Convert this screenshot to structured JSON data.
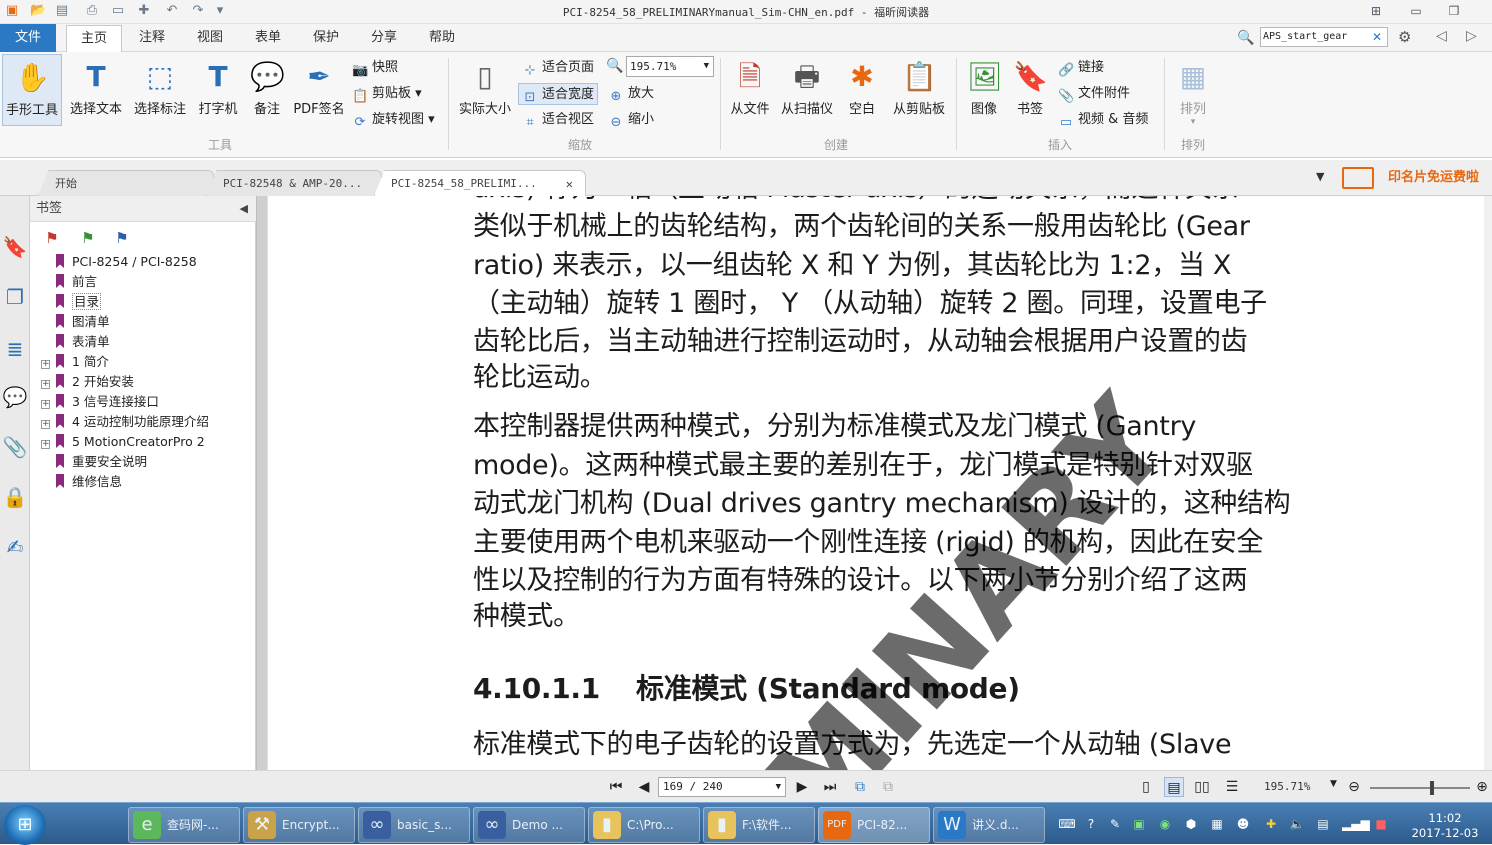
{
  "window": {
    "title": "PCI-8254_58_PRELIMINARYmanual_Sim-CHN_en.pdf - 福昕阅读器"
  },
  "menubar": {
    "items": [
      {
        "label": "文件"
      },
      {
        "label": "主页"
      },
      {
        "label": "注释"
      },
      {
        "label": "视图"
      },
      {
        "label": "表单"
      },
      {
        "label": "保护"
      },
      {
        "label": "分享"
      },
      {
        "label": "帮助"
      }
    ],
    "search_value": "APS_start_gear"
  },
  "ribbon": {
    "tools": [
      {
        "label": "手形工具",
        "icon": "hand-icon"
      },
      {
        "label": "选择文本",
        "icon": "text-select-icon"
      },
      {
        "label": "选择标注",
        "icon": "annotation-select-icon"
      },
      {
        "label": "打字机",
        "icon": "typewriter-icon"
      },
      {
        "label": "备注",
        "icon": "note-icon"
      },
      {
        "label": "PDF签名",
        "icon": "signature-icon"
      }
    ],
    "tools_small": [
      {
        "label": "快照",
        "icon": "camera-icon"
      },
      {
        "label": "剪贴板",
        "icon": "clipboard-icon"
      },
      {
        "label": "旋转视图",
        "icon": "rotate-icon"
      }
    ],
    "tools_group": "工具",
    "actual_size": "实际大小",
    "zoom_small": [
      {
        "label": "适合页面"
      },
      {
        "label": "适合宽度"
      },
      {
        "label": "适合视区"
      }
    ],
    "zoom_value": "195.71%",
    "zoom_in": "放大",
    "zoom_out": "缩小",
    "zoom_group": "缩放",
    "create": [
      {
        "label": "从文件"
      },
      {
        "label": "从扫描仪"
      },
      {
        "label": "空白"
      },
      {
        "label": "从剪贴板"
      }
    ],
    "create_group": "创建",
    "insert_big": [
      {
        "label": "图像"
      },
      {
        "label": "书签"
      }
    ],
    "insert_small": [
      {
        "label": "链接"
      },
      {
        "label": "文件附件"
      },
      {
        "label": "视频 & 音频"
      }
    ],
    "insert_group": "插入",
    "arrange": "排列",
    "arrange_group": "排列"
  },
  "tabs": [
    {
      "label": "开始"
    },
    {
      "label": "PCI-82548 & AMP-20..."
    },
    {
      "label": "PCI-8254_58_PRELIMI..."
    }
  ],
  "ad_text": "印名片免运费啦",
  "bookmarks": {
    "title": "书签",
    "items": [
      {
        "label": "PCI-8254 / PCI-8258",
        "expandable": false
      },
      {
        "label": "前言",
        "expandable": false
      },
      {
        "label": "目录",
        "expandable": false
      },
      {
        "label": "图清单",
        "expandable": false
      },
      {
        "label": "表清单",
        "expandable": false
      },
      {
        "label": "1 简介",
        "expandable": true
      },
      {
        "label": "2 开始安装",
        "expandable": true
      },
      {
        "label": "3 信号连接接口",
        "expandable": true
      },
      {
        "label": "4 运动控制功能原理介绍",
        "expandable": true
      },
      {
        "label": "5 MotionCreatorPro 2",
        "expandable": true
      },
      {
        "label": "重要安全说明",
        "expandable": false
      },
      {
        "label": "维修信息",
        "expandable": false
      }
    ]
  },
  "document": {
    "lines": [
      "axis) 称为一轴（主动轴 Master axis）的运动关系，而这种关系",
      "类似于机械上的齿轮结构，两个齿轮间的关系一般用齿轮比 (Gear",
      "ratio) 来表示，以一组齿轮 X 和 Y 为例，其齿轮比为 1:2，当 X",
      "（主动轴）旋转 1 圈时， Y （从动轴）旋转 2 圈。同理，设置电子",
      "齿轮比后，当主动轴进行控制运动时，从动轴会根据用户设置的齿",
      "轮比运动。",
      "本控制器提供两种模式，分别为标准模式及龙门模式 (Gantry",
      "mode)。这两种模式最主要的差别在于，龙门模式是特别针对双驱",
      "动式龙门机构 (Dual drives gantry mechanism) 设计的，这种结构",
      "主要使用两个电机来驱动一个刚性连接 (rigid) 的机构，因此在安全",
      "性以及控制的行为方面有特殊的设计。以下两小节分别介绍了这两",
      "种模式。"
    ],
    "heading_number": "4.10.1.1",
    "heading_text": "标准模式 (Standard mode)",
    "last_line": "标准模式下的电子齿轮的设置方式为，先选定一个从动轴 (Slave",
    "watermark": "MINARY"
  },
  "status": {
    "page": "169 / 240",
    "zoom": "195.71%"
  },
  "taskbar": {
    "items": [
      {
        "label": "查码网-...",
        "color": "#5cb85c"
      },
      {
        "label": "Encrypt...",
        "color": "#c9a24a"
      },
      {
        "label": "basic_s...",
        "color": "#3a5fa0"
      },
      {
        "label": "Demo ...",
        "color": "#3a5fa0"
      },
      {
        "label": "C:\\Pro...",
        "color": "#e8c25a"
      },
      {
        "label": "F:\\软件...",
        "color": "#e8c25a"
      },
      {
        "label": "PCI-82...",
        "color": "#e8670f"
      },
      {
        "label": "讲义.d...",
        "color": "#2b79c4"
      }
    ],
    "time": "11:02",
    "date": "2017-12-03"
  }
}
